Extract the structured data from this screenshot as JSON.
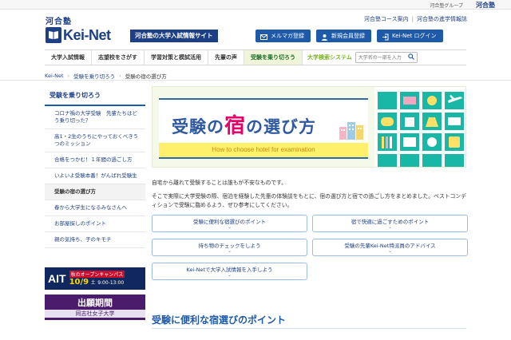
{
  "top_strip": {
    "group_text": "河合塾グループ",
    "group_logo": "河合塾"
  },
  "header": {
    "logo_small": "河合塾",
    "logo_main": "Kei-Net",
    "site_tag": "河合塾の大学入試情報サイト",
    "top_links": [
      "河合塾コース案内",
      "河合塾の進学情報誌"
    ],
    "buttons": [
      {
        "label": "メルマガ登録",
        "icon": "mail-icon"
      },
      {
        "label": "新規会員登録",
        "icon": "user-add-icon"
      },
      {
        "label": "Kei-Net ログイン",
        "icon": "login-icon"
      }
    ]
  },
  "nav": {
    "items": [
      "大学入試情報",
      "志望校をさがす",
      "学習対策と模試活用",
      "先輩の声",
      "受験を乗り切ろう"
    ],
    "active_index": 4,
    "search_label": "大学検索システム",
    "search_placeholder": "大学名の一部を入力"
  },
  "breadcrumb": [
    "Kei-Net",
    "受験を乗り切ろう",
    "受験の宿の選び方"
  ],
  "sidebar": {
    "title": "受験を乗り切ろう",
    "items": [
      "コロナ禍の大学受験　先輩たちはどう乗り切った？",
      "高1・2生のうちにやっておくべき５つのミッション",
      "合格をつかむ！１年間の過ごし方",
      "いよいよ受験本番！がんばれ受験生",
      "受験の宿の選び方",
      "春から大学生になるみなさんへ",
      "お部屋探しのポイント",
      "親の気持ち、子のキモチ"
    ],
    "active_index": 4
  },
  "banners": {
    "ait": {
      "logo": "AIT",
      "event": "秋のオープンキャンパス",
      "date": "10/9",
      "day": "土",
      "time": "9:00-13:00"
    },
    "dwc": {
      "title": "出願期間",
      "school": "同志社女子大学"
    }
  },
  "hero": {
    "title_pre": "受験の",
    "title_big": "宿",
    "title_post": "の選び方",
    "subtitle": "How to choose hotel for examination"
  },
  "intro": [
    "自宅から離れて受験することは誰もが不安なものです。",
    "そこで実際に大学受験の際、宿泊を経験した先輩の体験談をもとに、宿の選び方と宿での過ごし方をまとめました。ベストコンディションで受験に臨めるよう、ぜひ参考にしてください。"
  ],
  "links": [
    "受験に便利な宿選びのポイント",
    "宿で快適に過ごすためのポイント",
    "持ち物のチェックをしよう",
    "受験の先輩Kei-Net特派員のアドバイス",
    "Kei-Netで大学入試情報を入手しよう"
  ],
  "section_title": "受験に便利な宿選びのポイント",
  "colors": {
    "brand_navy": "#1d3f86",
    "button_blue": "#1d5aa9",
    "accent_green": "#7cb32b",
    "accent_pink": "#e5006a",
    "hero_teal": "#19b8a6"
  }
}
